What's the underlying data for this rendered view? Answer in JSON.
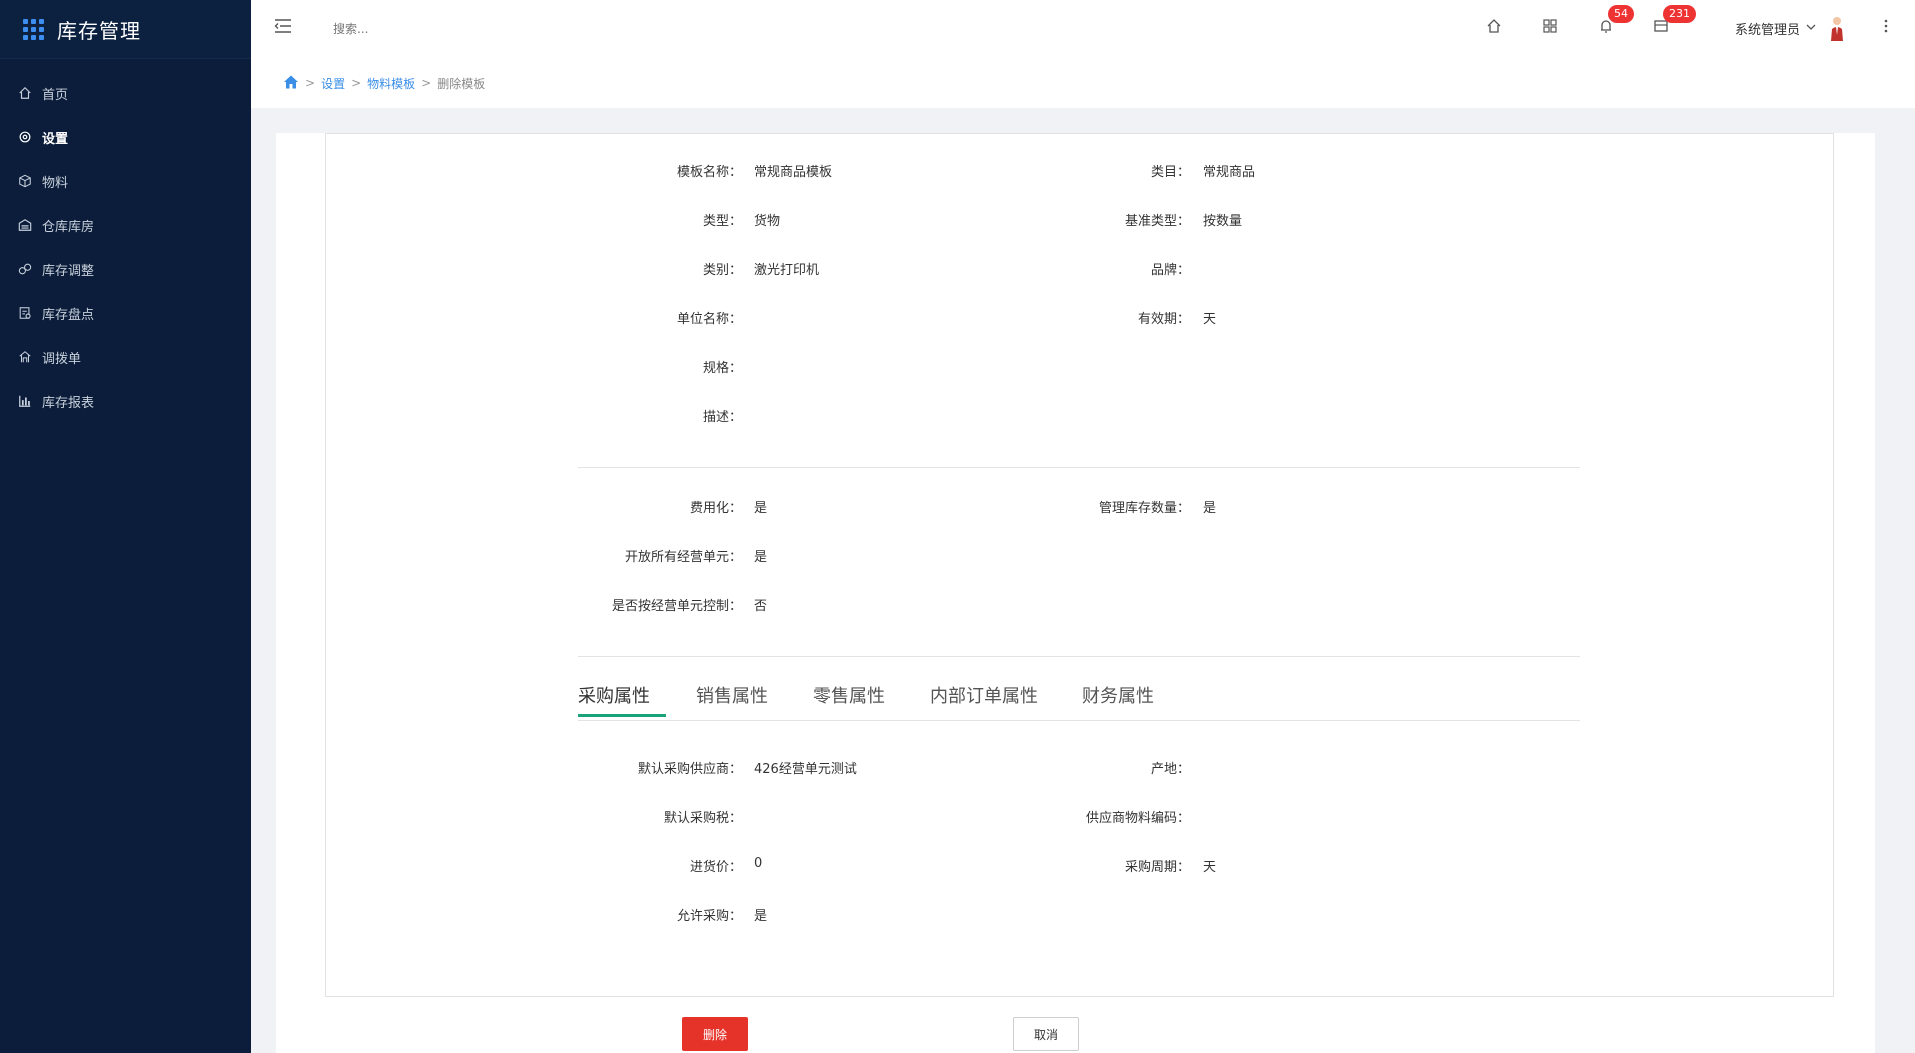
{
  "app": {
    "title": "库存管理"
  },
  "sidebar": {
    "items": [
      {
        "label": "首页",
        "icon": "home-icon"
      },
      {
        "label": "设置",
        "icon": "gear-icon",
        "active": true
      },
      {
        "label": "物料",
        "icon": "cube-icon"
      },
      {
        "label": "仓库库房",
        "icon": "warehouse-icon"
      },
      {
        "label": "库存调整",
        "icon": "adjust-icon"
      },
      {
        "label": "库存盘点",
        "icon": "checklist-icon"
      },
      {
        "label": "调拨单",
        "icon": "transfer-icon"
      },
      {
        "label": "库存报表",
        "icon": "bar-chart-icon"
      }
    ]
  },
  "header": {
    "search_placeholder": "搜索...",
    "notifications_count": "54",
    "messages_count": "231",
    "user_name": "系统管理员"
  },
  "breadcrumb": {
    "items": [
      "设置",
      "物料模板",
      "删除模板"
    ]
  },
  "detail": {
    "section1": {
      "template_name_label": "模板名称：",
      "template_name": "常规商品模板",
      "category_label": "类目：",
      "category": "常规商品",
      "type_label": "类型：",
      "type": "货物",
      "base_type_label": "基准类型：",
      "base_type": "按数量",
      "class_label": "类别：",
      "class": "激光打印机",
      "brand_label": "品牌：",
      "brand": "",
      "unit_label": "单位名称：",
      "unit": "",
      "validity_label": "有效期：",
      "validity": "天",
      "spec_label": "规格：",
      "spec": "",
      "desc_label": "描述：",
      "desc": ""
    },
    "section2": {
      "expense_label": "费用化：",
      "expense": "是",
      "manage_stock_label": "管理库存数量：",
      "manage_stock": "是",
      "open_units_label": "开放所有经营单元：",
      "open_units": "是",
      "unit_control_label": "是否按经营单元控制：",
      "unit_control": "否"
    },
    "tabs": [
      "采购属性",
      "销售属性",
      "零售属性",
      "内部订单属性",
      "财务属性"
    ],
    "purchase": {
      "supplier_label": "默认采购供应商：",
      "supplier": "426经营单元测试",
      "origin_label": "产地：",
      "origin": "",
      "tax_label": "默认采购税：",
      "tax": "",
      "supplier_code_label": "供应商物料编码：",
      "supplier_code": "",
      "price_label": "进货价：",
      "price": "0",
      "cycle_label": "采购周期：",
      "cycle": "天",
      "allow_label": "允许采购：",
      "allow": "是"
    }
  },
  "actions": {
    "delete_label": "删除",
    "cancel_label": "取消"
  },
  "colors": {
    "sidebar_bg": "#0b1d3a",
    "accent": "#1aa37a",
    "danger": "#e6332a",
    "link": "#3a8ee6"
  }
}
